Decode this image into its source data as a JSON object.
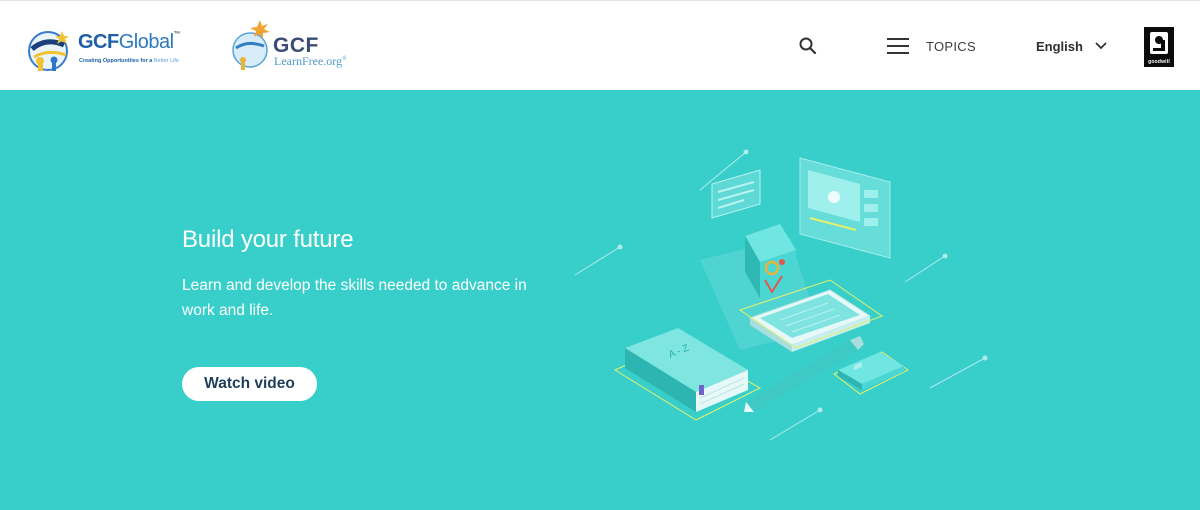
{
  "header": {
    "logo_global": {
      "word_bold": "GCF",
      "word_light": "Global",
      "trademark": "™",
      "tagline_main": "Creating Opportunities for a",
      "tagline_soft": "Better Life"
    },
    "logo_learnfree": {
      "gcf": "GCF",
      "learnfree": "LearnFree.org",
      "registered": "®"
    },
    "search_icon": "search-icon",
    "topics_label": "TOPICS",
    "menu_icon": "hamburger-menu-icon",
    "language_selected": "English",
    "language_icon": "chevron-down-icon",
    "goodwill_text": "goodwill"
  },
  "hero": {
    "title": "Build your future",
    "description": "Learn and develop the skills needed to advance in work and life.",
    "watch_button_label": "Watch video",
    "book_label": "A - Z"
  },
  "colors": {
    "hero_background": "#38cfcb",
    "header_background": "#ffffff",
    "button_text": "#1f3e5a",
    "accent_yellow": "#e3f06b"
  }
}
